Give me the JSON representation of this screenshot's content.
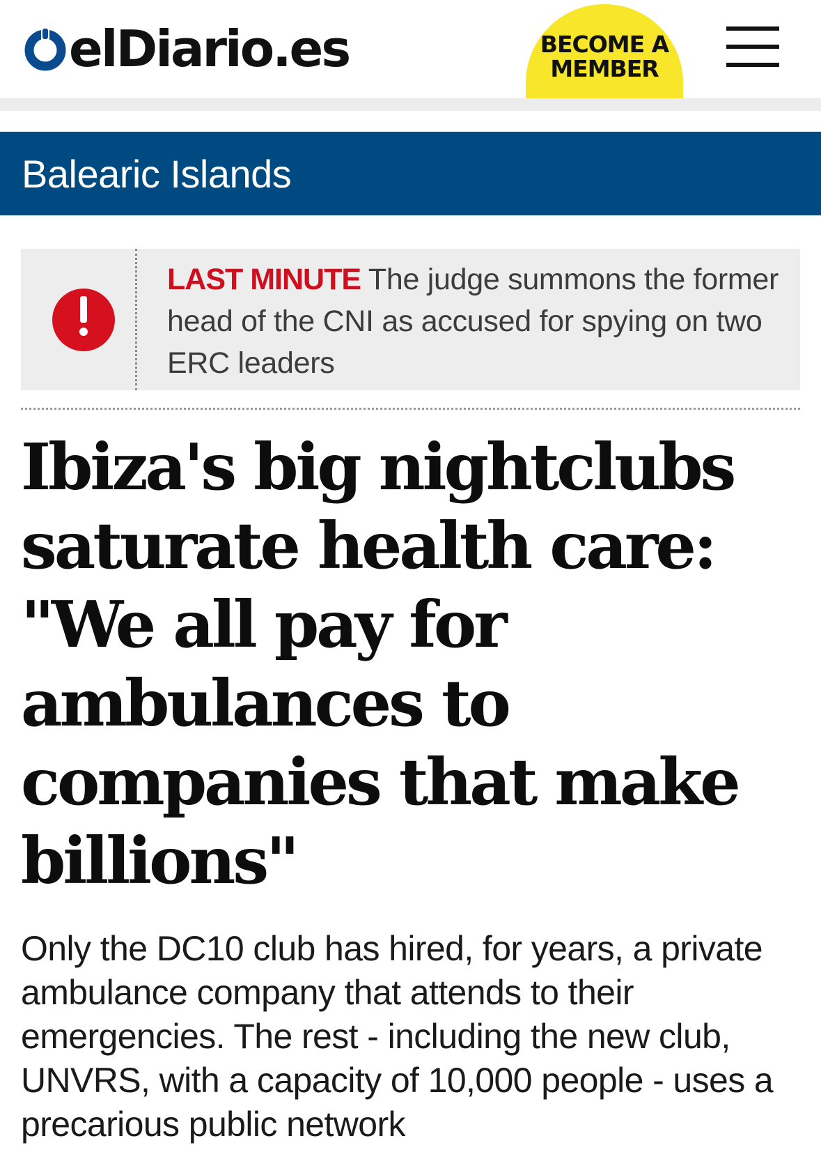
{
  "header": {
    "logo_text": "elDiario.es",
    "member_button": "BECOME A MEMBER"
  },
  "section": {
    "title": "Balearic Islands"
  },
  "breaking": {
    "kicker": "LAST MINUTE",
    "text": "The judge summons the former head of the CNI as accused for spying on two ERC leaders"
  },
  "article": {
    "headline": "Ibiza's big nightclubs saturate health care: \"We all pay for ambulances to companies that make billions\"",
    "subheadline": "Only the DC10 club has hired, for years, a private ambulance company that attends to their emergencies. The rest - including the new club, UNVRS, with a capacity of 10,000 people - uses a precarious public network"
  },
  "icons": {
    "logo_mark": "eldiario-logo-icon",
    "menu": "hamburger-menu-icon",
    "alert": "alert-icon"
  },
  "colors": {
    "brand_blue": "#004a82",
    "member_yellow": "#f7e62a",
    "alert_red": "#cc1020"
  }
}
